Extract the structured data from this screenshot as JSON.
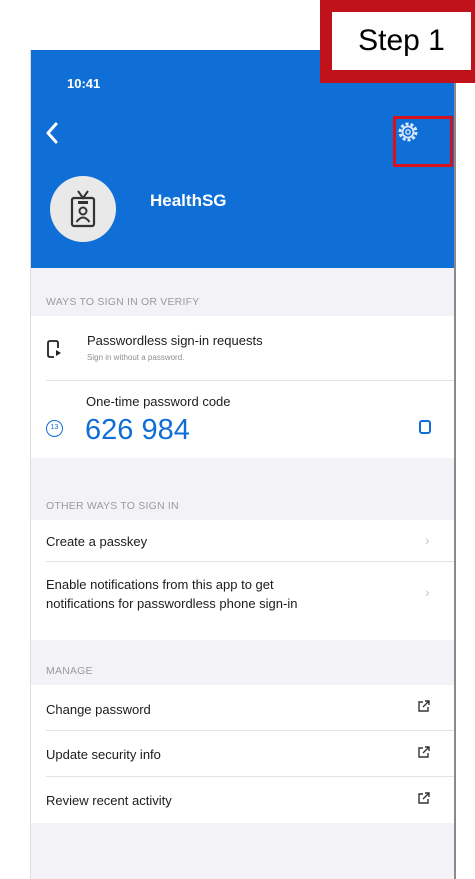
{
  "callout": {
    "label": "Step 1"
  },
  "status_bar": {
    "time": "10:41"
  },
  "header": {
    "back_icon": "chevron-left-icon",
    "settings_icon": "gear-icon",
    "account_name": "HealthSG",
    "brand_color": "#0f6fd6"
  },
  "sections": {
    "sign_in": {
      "header": "WAYS TO SIGN IN OR VERIFY",
      "passwordless": {
        "title": "Passwordless sign-in requests",
        "subtitle": "Sign in without a password."
      },
      "otp": {
        "title": "One-time password code",
        "timer": "13",
        "code": "626 984"
      }
    },
    "other_ways": {
      "header": "OTHER WAYS TO SIGN IN",
      "create_passkey": "Create a passkey",
      "notifications_line1": "Enable notifications from this app to get",
      "notifications_line2": "notifications for passwordless phone sign-in"
    },
    "manage": {
      "header": "MANAGE",
      "change_password": "Change password",
      "update_security": "Update security info",
      "review_activity": "Review recent activity"
    }
  },
  "highlight_color": "#d8101a"
}
